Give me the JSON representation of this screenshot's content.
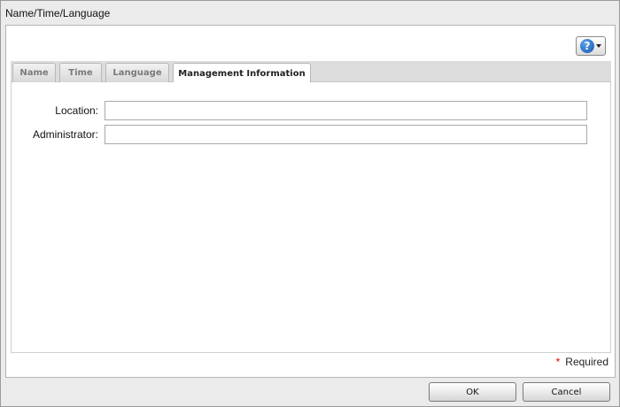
{
  "dialog": {
    "title": "Name/Time/Language"
  },
  "help": {
    "icon": "help-icon",
    "glyph": "?"
  },
  "tabs": [
    {
      "label": "Name",
      "active": false
    },
    {
      "label": "Time",
      "active": false
    },
    {
      "label": "Language",
      "active": false
    },
    {
      "label": "Management Information",
      "active": true
    }
  ],
  "form": {
    "location_label": "Location:",
    "location_value": "",
    "administrator_label": "Administrator:",
    "administrator_value": ""
  },
  "required_note": {
    "star": "*",
    "text": "Required"
  },
  "buttons": {
    "ok": "OK",
    "cancel": "Cancel"
  },
  "colors": {
    "help_blue": "#1658b0",
    "required_star": "#dd0000"
  }
}
